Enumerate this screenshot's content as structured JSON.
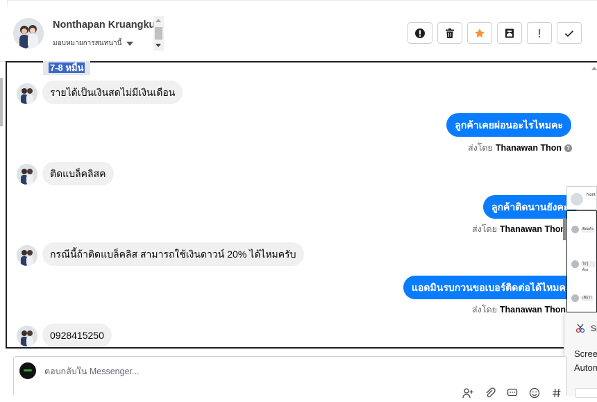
{
  "header": {
    "contact_name": "Nonthapan Kruangkun",
    "assign_label": "มอบหมายการสนทนานี้"
  },
  "toolbar": {
    "buttons": [
      {
        "name": "spam",
        "icon": "alert-circle-icon",
        "color": "#1c1e21"
      },
      {
        "name": "delete",
        "icon": "trash-icon",
        "color": "#1c1e21"
      },
      {
        "name": "star",
        "icon": "star-icon",
        "color": "#f7923b"
      },
      {
        "name": "archive",
        "icon": "archive-icon",
        "color": "#1c1e21"
      },
      {
        "name": "priority",
        "icon": "exclamation-icon",
        "color": "#e03b2c"
      },
      {
        "name": "done",
        "icon": "check-icon",
        "color": "#1c1e21"
      }
    ]
  },
  "chat": {
    "date_tag": "7-8 หมื่น",
    "messages": [
      {
        "direction": "in",
        "text": "รายได้เป็นเงินสดไม่มีเงินเดือน"
      },
      {
        "direction": "out",
        "text": "ลูกค้าเคยผ่อนอะไรไหมคะ",
        "sent_by_label": "ส่งโดย",
        "sent_by": "Thanawan Thon"
      },
      {
        "direction": "in",
        "text": "ติดแบล็คลิสค"
      },
      {
        "direction": "out",
        "text": "ลูกค้าติดนานยังคะ",
        "sent_by_label": "ส่งโดย",
        "sent_by": "Thanawan Thon"
      },
      {
        "direction": "in",
        "text": "กรณีนี้ถ้าติดแบล็คลิส สามารถใช้เงินดาวน์ 20% ได้ไหมครับ"
      },
      {
        "direction": "out",
        "text": "แอดมินรบกวนขอเบอร์ติดต่อได้ไหมคะ",
        "sent_by_label": "ส่งโดย",
        "sent_by": "Thanawan Thon"
      },
      {
        "direction": "in",
        "text": "0928415250"
      }
    ],
    "accent_color": "#0a7cff"
  },
  "overlay": {
    "mini_name": "Nont",
    "rows": [
      "ติดแล้ว",
      "ไม่รู้ ต้อง",
      "เพิ่มว่า"
    ],
    "snip_title": "Sn",
    "snip_line1": "Scree",
    "snip_line2": "Autom"
  },
  "composer": {
    "placeholder": "ตอบกลับใน Messenger..."
  }
}
